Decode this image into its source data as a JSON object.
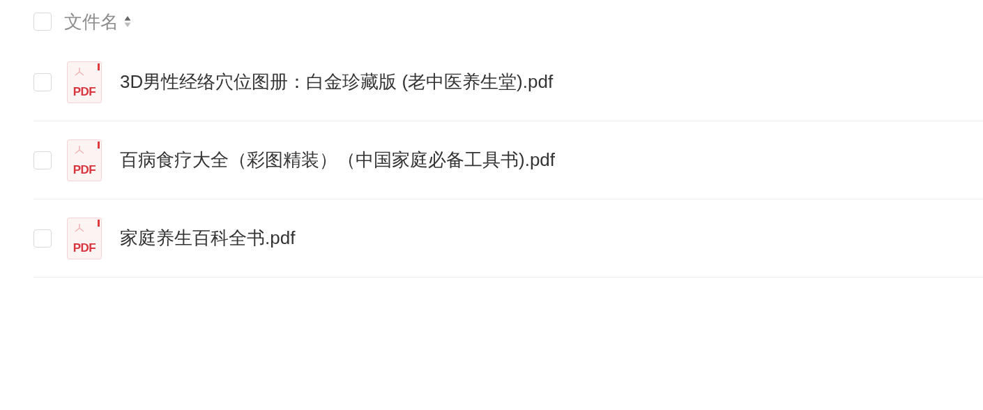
{
  "header": {
    "checked": false,
    "label": "文件名"
  },
  "files": [
    {
      "name": "3D男性经络穴位图册：白金珍藏版 (老中医养生堂).pdf",
      "type_label": "PDF",
      "checked": false
    },
    {
      "name": "百病食疗大全（彩图精装）（中国家庭必备工具书).pdf",
      "type_label": "PDF",
      "checked": false
    },
    {
      "name": "家庭养生百科全书.pdf",
      "type_label": "PDF",
      "checked": false
    }
  ]
}
